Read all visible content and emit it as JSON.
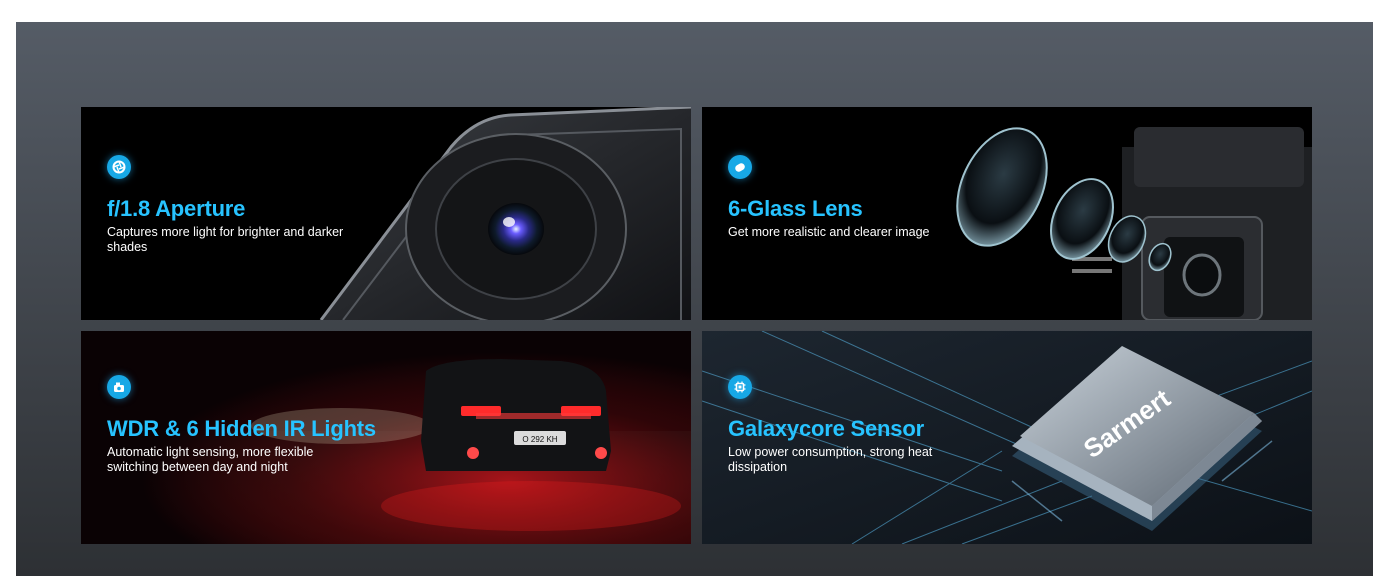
{
  "features": [
    {
      "icon": "aperture-icon",
      "title": "f/1.8 Aperture",
      "description": "Captures more light for brighter and darker shades"
    },
    {
      "icon": "lens-icon",
      "title": "6-Glass Lens",
      "description": "Get more realistic and clearer image"
    },
    {
      "icon": "camera-icon",
      "title": "WDR & 6 Hidden IR Lights",
      "description": "Automatic light sensing, more flexible switching between day and night"
    },
    {
      "icon": "chip-icon",
      "title": "Galaxycore Sensor",
      "description": "Low power consumption, strong heat dissipation"
    }
  ],
  "chip_brand": "Sarmert",
  "license_plate": "O 292 KH",
  "colors": {
    "accent": "#27c3ff",
    "badge": "#17a8e6",
    "background_top": "#555c66",
    "background_bottom": "#2d3034"
  }
}
